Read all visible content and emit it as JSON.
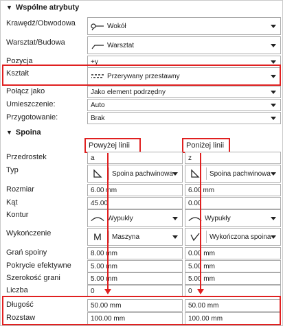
{
  "sections": {
    "common": "Wspólne atrybuty",
    "weld": "Spoina"
  },
  "common": {
    "edge_label": "Krawędź/Obwodowa",
    "edge_value": "Wokół",
    "workshop_label": "Warsztat/Budowa",
    "workshop_value": "Warsztat",
    "position_label": "Pozycja",
    "position_value": "+y",
    "shape_label": "Kształt",
    "shape_value": "Przerywany przestawny",
    "connect_label": "Połącz jako",
    "connect_value": "Jako element podrzędny",
    "placement_label": "Umieszczenie:",
    "placement_value": "Auto",
    "prep_label": "Przygotowanie:",
    "prep_value": "Brak"
  },
  "weld": {
    "above_header": "Powyżej linii",
    "below_header": "Poniżej linii",
    "rows": {
      "prefix": "Przedrostek",
      "type": "Typ",
      "size": "Rozmiar",
      "angle": "Kąt",
      "contour": "Kontur",
      "finish": "Wykończenie",
      "root": "Grań spoiny",
      "coverage": "Pokrycie efektywne",
      "width": "Szerokość grani",
      "count": "Liczba",
      "length": "Długość",
      "spacing": "Rozstaw"
    },
    "above": {
      "prefix": "a",
      "type": "Spoina pachwinowa",
      "size_num": "6.00",
      "size_unit": "mm",
      "angle": "45.00",
      "contour": "Wypukły",
      "finish_icon": "M",
      "finish": "Maszyna",
      "root": "8.00 mm",
      "coverage": "5.00 mm",
      "width": "5.00 mm",
      "count": "0",
      "length": "50.00 mm",
      "spacing": "100.00 mm"
    },
    "below": {
      "prefix": "z",
      "type": "Spoina pachwinowa",
      "size_num": "6.00",
      "size_unit": "mm",
      "angle": "0.00",
      "contour": "Wypukły",
      "finish": "Wykończona spoina",
      "root": "0.00 mm",
      "coverage": "5.00 mm",
      "width": "5.00 mm",
      "count": "0",
      "length": "50.00 mm",
      "spacing": "100.00 mm"
    }
  },
  "colors": {
    "highlight": "#e02020"
  },
  "icons": {
    "edge": "weld-around-icon",
    "workshop": "flag-icon",
    "shape": "staggered-dash-icon",
    "type": "fillet-weld-icon",
    "contour": "convex-arc-icon",
    "finish_below": "check-finish-icon"
  }
}
